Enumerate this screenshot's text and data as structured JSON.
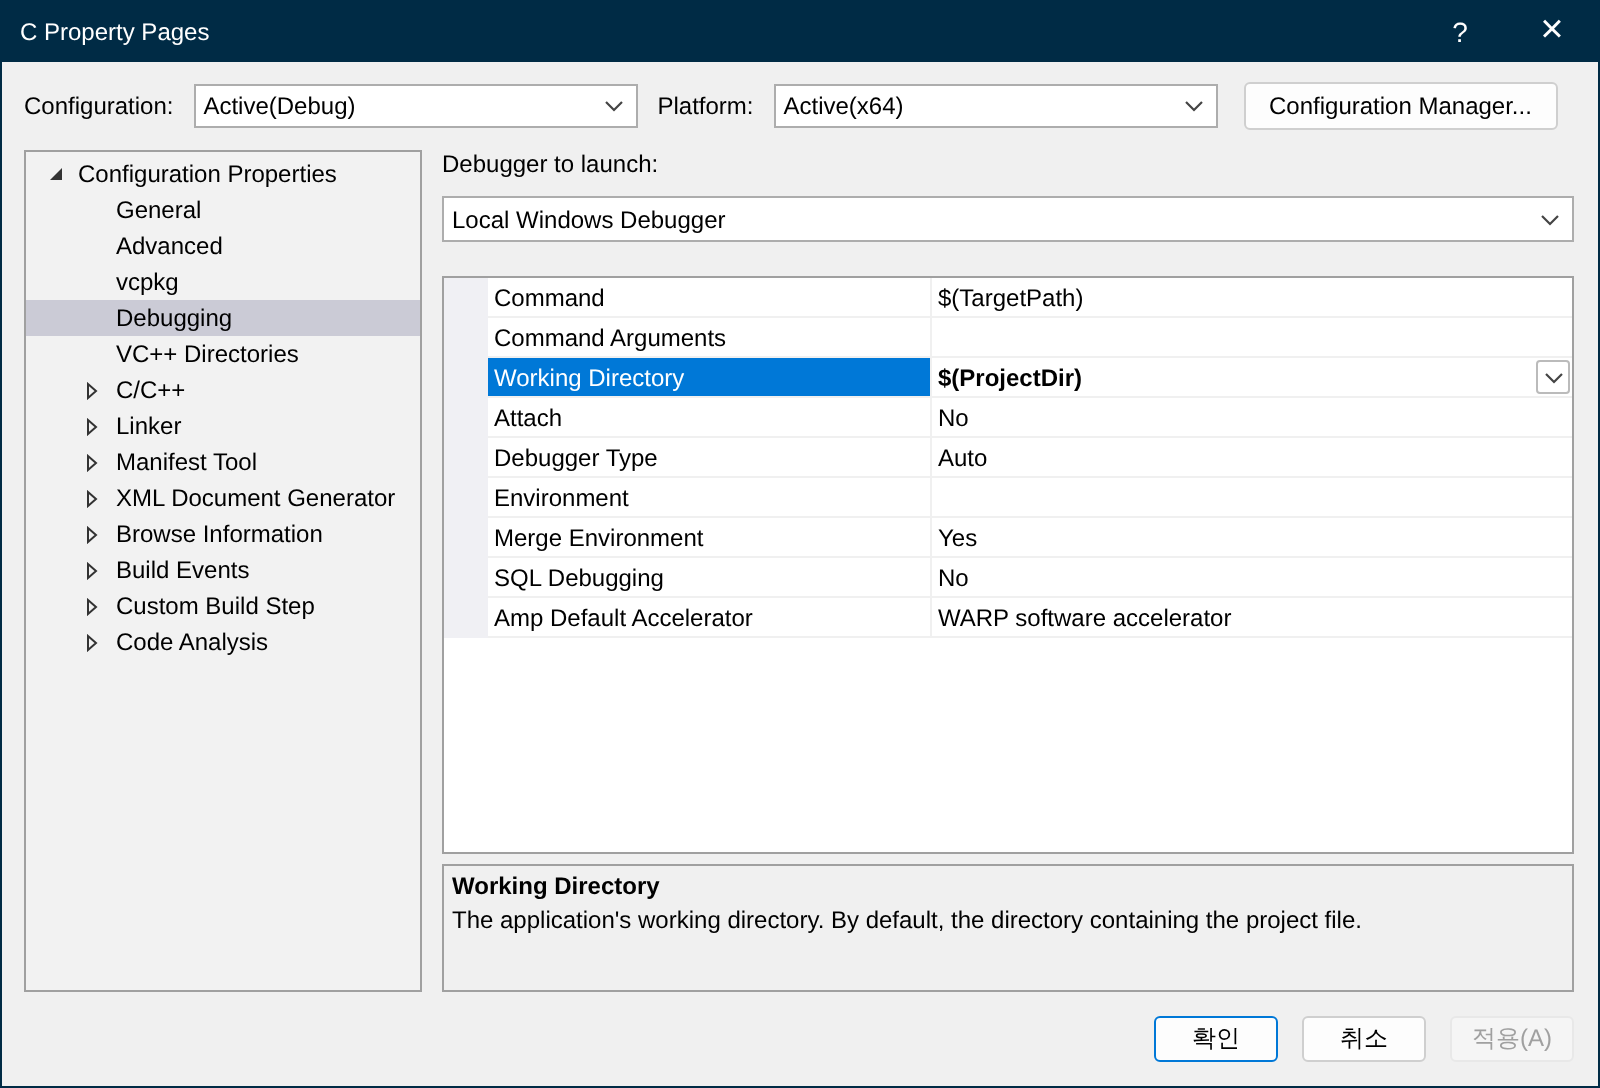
{
  "window": {
    "title": "C Property Pages",
    "help": "?",
    "close": "×"
  },
  "configuration": {
    "label": "Configuration:",
    "value": "Active(Debug)"
  },
  "platform": {
    "label": "Platform:",
    "value": "Active(x64)"
  },
  "config_manager_button": "Configuration Manager...",
  "tree": [
    {
      "label": "Configuration Properties",
      "expanded": true,
      "children": [
        {
          "label": "General",
          "selected": false,
          "expandable": false
        },
        {
          "label": "Advanced",
          "selected": false,
          "expandable": false
        },
        {
          "label": "vcpkg",
          "selected": false,
          "expandable": false
        },
        {
          "label": "Debugging",
          "selected": true,
          "expandable": false
        },
        {
          "label": "VC++ Directories",
          "selected": false,
          "expandable": false
        },
        {
          "label": "C/C++",
          "selected": false,
          "expandable": true
        },
        {
          "label": "Linker",
          "selected": false,
          "expandable": true
        },
        {
          "label": "Manifest Tool",
          "selected": false,
          "expandable": true
        },
        {
          "label": "XML Document Generator",
          "selected": false,
          "expandable": true
        },
        {
          "label": "Browse Information",
          "selected": false,
          "expandable": true
        },
        {
          "label": "Build Events",
          "selected": false,
          "expandable": true
        },
        {
          "label": "Custom Build Step",
          "selected": false,
          "expandable": true
        },
        {
          "label": "Code Analysis",
          "selected": false,
          "expandable": true
        }
      ]
    }
  ],
  "debugger": {
    "label": "Debugger to launch:",
    "value": "Local Windows Debugger"
  },
  "properties": [
    {
      "name": "Command",
      "value": "$(TargetPath)",
      "selected": false,
      "bold": false
    },
    {
      "name": "Command Arguments",
      "selected": false
    },
    {
      "name": "Working Directory",
      "value": "$(ProjectDir)",
      "selected": true,
      "bold": true
    },
    {
      "name": "Attach",
      "value": "No",
      "selected": false,
      "bold": false
    },
    {
      "name": "Debugger Type",
      "value": "Auto",
      "selected": false,
      "bold": false
    },
    {
      "name": "Environment",
      "selected": false
    },
    {
      "name": "Merge Environment",
      "value": "Yes",
      "selected": false,
      "bold": false
    },
    {
      "name": "SQL Debugging",
      "value": "No",
      "selected": false,
      "bold": false
    },
    {
      "name": "Amp Default Accelerator",
      "value": "WARP software accelerator",
      "selected": false,
      "bold": false
    }
  ],
  "description": {
    "title": "Working Directory",
    "text": "The application's working directory. By default, the directory containing the project file."
  },
  "buttons": [
    {
      "label": "확인",
      "kind": "default",
      "disabled": false
    },
    {
      "label": "취소",
      "kind": "normal",
      "disabled": false
    },
    {
      "label": "적용(A)",
      "kind": "normal",
      "disabled": true
    }
  ]
}
